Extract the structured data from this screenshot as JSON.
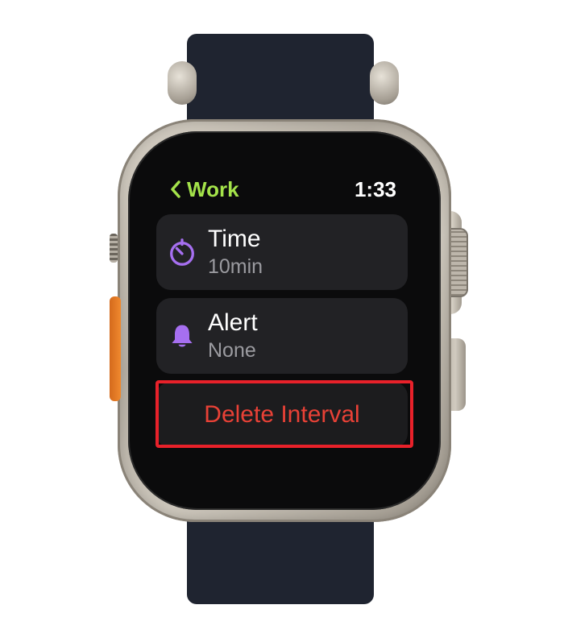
{
  "header": {
    "back_label": "Work",
    "clock": "1:33"
  },
  "rows": [
    {
      "title": "Time",
      "value": "10min",
      "icon": "timer-icon"
    },
    {
      "title": "Alert",
      "value": "None",
      "icon": "bell-icon"
    }
  ],
  "delete_label": "Delete Interval",
  "colors": {
    "accent_green": "#a4e34a",
    "icon_purple": "#a66ff0",
    "delete_red": "#e84136",
    "highlight_red": "#e8212a"
  }
}
